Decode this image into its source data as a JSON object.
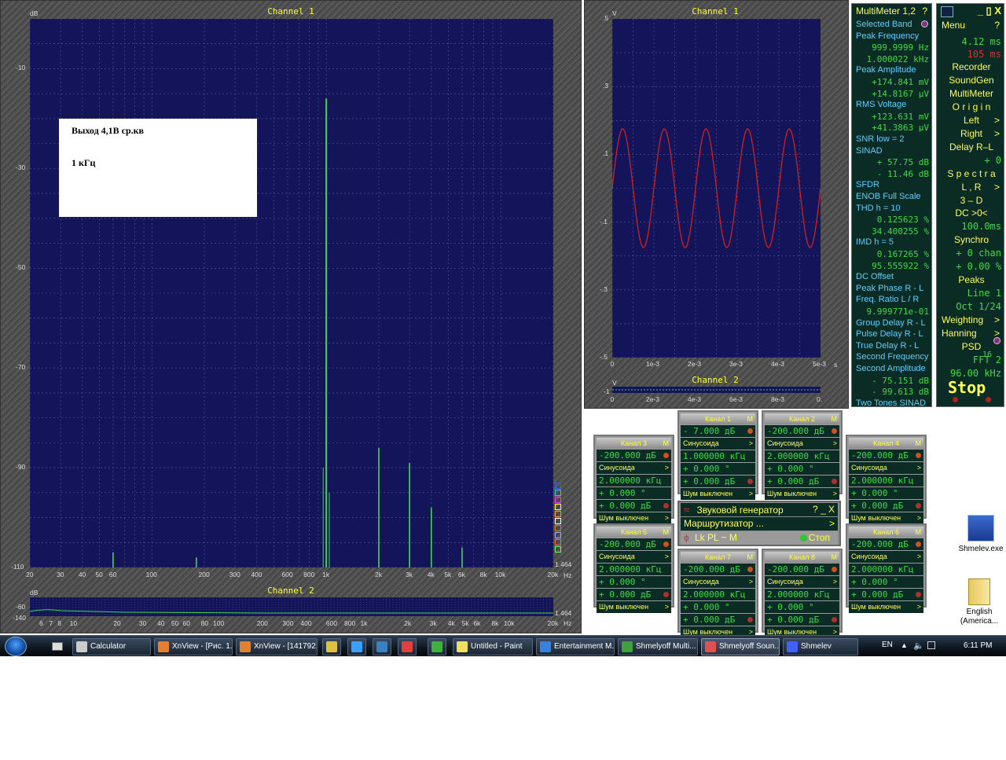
{
  "spectrum": {
    "ch1_title": "Channel 1",
    "ch2_title": "Channel 2",
    "ylabel": "dB",
    "xunit": "Hz",
    "yticks": [
      "-10",
      "-30",
      "-50",
      "-70",
      "-90",
      "-110"
    ],
    "xticks": [
      "20",
      "30",
      "40",
      "50",
      "60",
      "100",
      "200",
      "300",
      "400",
      "600",
      "800",
      "1k",
      "2k",
      "3k",
      "4k",
      "5k",
      "6k",
      "8k",
      "10k",
      "20k"
    ],
    "ch2_yticks": [
      "-60",
      "-140"
    ],
    "ch2_xticks": [
      "6",
      "7",
      "8",
      "10",
      "20",
      "30",
      "40",
      "50",
      "60",
      "80",
      "100",
      "200",
      "300",
      "400",
      "600",
      "800",
      "1k",
      "2k",
      "3k",
      "4k",
      "5k",
      "6k",
      "8k",
      "10k",
      "20k"
    ],
    "scale_value": "1.464",
    "ch2_scale_value": "1.464",
    "note_line1": "Выход 4,1В ср.кв",
    "note_line2": "1 кГц"
  },
  "chart_data": [
    {
      "type": "bar",
      "title": "Channel 1",
      "ylabel": "dB",
      "xlabel": "Hz",
      "log_x": true,
      "xlim": [
        20,
        20000
      ],
      "ylim": [
        -110,
        0
      ],
      "x": [
        60,
        180,
        1000,
        2000,
        3000,
        4000,
        6000
      ],
      "values": [
        -107,
        -108,
        -16,
        -86,
        -89,
        -98,
        -106
      ]
    },
    {
      "type": "line",
      "title": "Channel 1",
      "ylabel": "V",
      "xlabel": "s",
      "xlim": [
        0,
        0.005
      ],
      "ylim": [
        -0.5,
        0.5
      ],
      "amplitude": 0.175,
      "frequency_hz": 1000
    }
  ],
  "scope": {
    "title": "Channel 1",
    "ch2_title": "Channel 2",
    "yunit": "V",
    "xunit": "s",
    "yticks": [
      ".5",
      ".3",
      ".1",
      "-.1",
      "-.3",
      "-.5"
    ],
    "xticks": [
      "0",
      "1e-3",
      "2e-3",
      "3e-3",
      "4e-3",
      "5e-3"
    ],
    "ch2_xticks": [
      "0",
      "2e-3",
      "4e-3",
      "6e-3",
      "8e-3",
      "0."
    ],
    "ch2_ytick": "-1",
    "ch2_yunit": "V"
  },
  "multimeter": {
    "title": "MultiMeter 1,2",
    "help": "?",
    "rows": [
      {
        "t": "lbl",
        "v": "Selected Band"
      },
      {
        "t": "lbl",
        "v": "Peak Frequency"
      },
      {
        "t": "val",
        "v": "999.9999 Hz"
      },
      {
        "t": "val",
        "v": "1.000022 kHz"
      },
      {
        "t": "lbl",
        "v": "Peak Amplitude"
      },
      {
        "t": "val",
        "v": "+174.841 mV"
      },
      {
        "t": "val",
        "v": "+14.8167 μV"
      },
      {
        "t": "lbl",
        "v": "RMS Voltage"
      },
      {
        "t": "val",
        "v": "+123.631 mV"
      },
      {
        "t": "val",
        "v": "+41.3863 μV"
      },
      {
        "t": "lbl",
        "v": "SNR      low =   2"
      },
      {
        "t": "lbl",
        "v": "SINAD"
      },
      {
        "t": "val",
        "v": "+ 57.75 dB"
      },
      {
        "t": "val",
        "v": "- 11.46 dB"
      },
      {
        "t": "lbl",
        "v": "SFDR"
      },
      {
        "t": "lbl",
        "v": "ENOB   Full Scale"
      },
      {
        "t": "lbl",
        "v": "THD       h =  10"
      },
      {
        "t": "val",
        "v": "0.125623 %"
      },
      {
        "t": "val",
        "v": "34.400255 %"
      },
      {
        "t": "lbl",
        "v": "IMD        h =   5"
      },
      {
        "t": "val",
        "v": "0.167265 %"
      },
      {
        "t": "val",
        "v": "95.555922 %"
      },
      {
        "t": "lbl",
        "v": "DC Offset"
      },
      {
        "t": "lbl",
        "v": "Peak Phase R - L"
      },
      {
        "t": "lbl",
        "v": "Freq. Ratio  L / R"
      },
      {
        "t": "val",
        "v": "9.999771e-01"
      },
      {
        "t": "lbl",
        "v": "Group Delay R - L"
      },
      {
        "t": "lbl",
        "v": "Pulse Delay R - L"
      },
      {
        "t": "lbl",
        "v": "True Delay R - L"
      },
      {
        "t": "lbl",
        "v": "Second Frequency"
      },
      {
        "t": "lbl",
        "v": "Second Amplitude"
      },
      {
        "t": "val",
        "v": "- 75.151 dB"
      },
      {
        "t": "val",
        "v": "- 99.613 dB"
      },
      {
        "t": "lbl",
        "v": "Two Tones SINAD"
      }
    ]
  },
  "menu": {
    "title": "Menu",
    "help": "?",
    "win_controls": "_ ▯ X",
    "time1": "4.12 ms",
    "time2": "105 ms",
    "items": [
      {
        "t": "it",
        "v": "Recorder"
      },
      {
        "t": "it",
        "v": "SoundGen"
      },
      {
        "t": "it",
        "v": "MultiMeter"
      },
      {
        "t": "it",
        "v": "O r i g i n"
      },
      {
        "t": "it",
        "v": "Left"
      },
      {
        "t": "it",
        "v": "Right"
      },
      {
        "t": "it",
        "v": "Delay R–L"
      },
      {
        "t": "val",
        "v": "+          0"
      },
      {
        "t": "it",
        "v": "S p e c t r a"
      },
      {
        "t": "it",
        "v": "L , R"
      },
      {
        "t": "it",
        "v": "3 – D"
      },
      {
        "t": "it",
        "v": "DC   >0<"
      },
      {
        "t": "val",
        "v": "100.0ms"
      },
      {
        "t": "it",
        "v": "Synchro"
      },
      {
        "t": "val",
        "v": "+ 0 chan"
      },
      {
        "t": "val",
        "v": "+ 0.00 %"
      },
      {
        "t": "it",
        "v": "Peaks"
      },
      {
        "t": "val",
        "v": "Line          1"
      },
      {
        "t": "val",
        "v": "Oct   1/24"
      },
      {
        "t": "it",
        "v": "Weighting"
      },
      {
        "t": "it",
        "v": "Hanning"
      },
      {
        "t": "it",
        "v": "PSD"
      },
      {
        "t": "val",
        "v": "FFT    2"
      },
      {
        "t": "val",
        "v": "96.00 kHz"
      }
    ],
    "fft_exp": "16",
    "stop": "Stop"
  },
  "generator": {
    "title": "Звуковой генератор",
    "router": "Маршрутизатор ...",
    "mode": "Lk PL ~ M",
    "stop": "Стоп",
    "help": "?  _  X"
  },
  "channels": [
    {
      "name": "Канал 1",
      "level": "-   7.000 дБ",
      "wave": "Синусоида",
      "freq": "1.000000 кГц",
      "phase": "+   0.000 °",
      "noise_level": "+   0.000 дБ",
      "noise": "Шум выключен"
    },
    {
      "name": "Канал 2",
      "level": "-200.000 дБ",
      "wave": "Синусоида",
      "freq": "2.000000 кГц",
      "phase": "+   0.000 °",
      "noise_level": "+   0.000 дБ",
      "noise": "Шум выключен"
    },
    {
      "name": "Канал 3",
      "level": "-200.000 дБ",
      "wave": "Синусоида",
      "freq": "2.000000 кГц",
      "phase": "+   0.000 °",
      "noise_level": "+   0.000 дБ",
      "noise": "Шум выключен"
    },
    {
      "name": "Канал 4",
      "level": "-200.000 дБ",
      "wave": "Синусоида",
      "freq": "2.000000 кГц",
      "phase": "+   0.000 °",
      "noise_level": "+   0.000 дБ",
      "noise": "Шум выключен"
    },
    {
      "name": "Канал 5",
      "level": "-200.000 дБ",
      "wave": "Синусоида",
      "freq": "2.000000 кГц",
      "phase": "+   0.000 °",
      "noise_level": "+   0.000 дБ",
      "noise": "Шум выключен"
    },
    {
      "name": "Канал 6",
      "level": "-200.000 дБ",
      "wave": "Синусоида",
      "freq": "2.000000 кГц",
      "phase": "+   0.000 °",
      "noise_level": "+   0.000 дБ",
      "noise": "Шум выключен"
    },
    {
      "name": "Канал 7",
      "level": "-200.000 дБ",
      "wave": "Синусоида",
      "freq": "2.000000 кГц",
      "phase": "+   0.000 °",
      "noise_level": "+   0.000 дБ",
      "noise": "Шум выключен"
    },
    {
      "name": "Канал 8",
      "level": "-200.000 дБ",
      "wave": "Синусоида",
      "freq": "2.000000 кГц",
      "phase": "+   0.000 °",
      "noise_level": "+   0.000 дБ",
      "noise": "Шум выключен"
    }
  ],
  "desktop": {
    "icon1": "Shmelev.exe",
    "icon2": "English (America..."
  },
  "taskbar": {
    "items": [
      "Calculator",
      "XnView - [Рис. 1...",
      "XnView - [141792...",
      "",
      "",
      "",
      "",
      "",
      "Untitled - Paint",
      "Entertainment M...",
      "Shmelyoff Multi...",
      "Shmelyoff Soun...",
      "Shmelev"
    ],
    "lang": "EN",
    "clock": "6:11 PM"
  },
  "colors": {
    "plot_bg": "#14145a",
    "spectrum": "#3ddc45",
    "scope_trace": "#d02020",
    "label_yellow": "#ffff33"
  }
}
